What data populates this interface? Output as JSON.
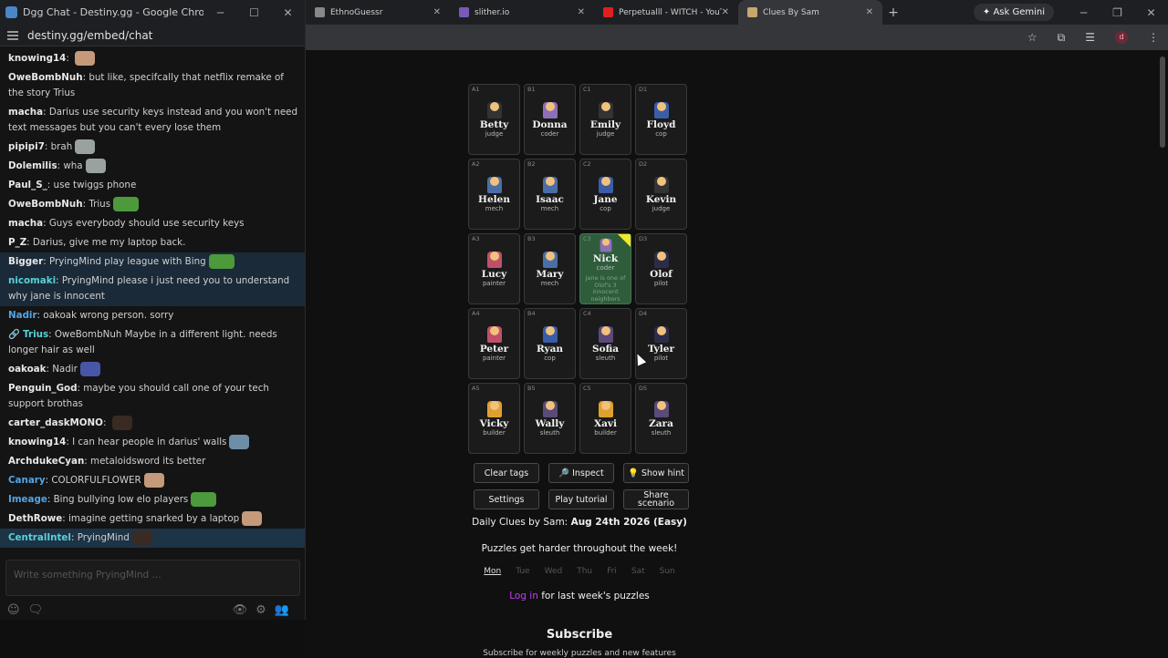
{
  "chat_window": {
    "title": "Dgg Chat - Destiny.gg - Google Chrome",
    "url": "destiny.gg/embed/chat",
    "input_placeholder": "Write something PryingMind ...",
    "messages": [
      {
        "user": "knowing14",
        "text": "",
        "emote": "face",
        "style": ""
      },
      {
        "user": "OweBombNuh",
        "text": "but like, specifcally that netflix remake of the story Trius",
        "emote": "",
        "style": ""
      },
      {
        "user": "macha",
        "text": "Darius use security keys instead and you won't need text messages but you can't every lose them",
        "emote": "",
        "style": ""
      },
      {
        "user": "pipipi7",
        "text": "brah",
        "emote": "grey",
        "style": ""
      },
      {
        "user": "Dolemilis",
        "text": "wha",
        "emote": "grey",
        "style": ""
      },
      {
        "user": "Paul_S_",
        "text": "use twiggs phone",
        "emote": "",
        "style": ""
      },
      {
        "user": "OweBombNuh",
        "text": "Trius",
        "emote": "pepe",
        "style": ""
      },
      {
        "user": "macha",
        "text": "Guys everybody should use security keys",
        "emote": "",
        "style": ""
      },
      {
        "user": "P_Z",
        "text": "Darius, give me my laptop back.",
        "emote": "",
        "style": ""
      },
      {
        "user": "Bigger",
        "text": "PryingMind play league with Bing",
        "emote": "pepe",
        "style": "hl"
      },
      {
        "user": "nicomaki",
        "text": "PryingMind please i just need you to understand why jane is innocent",
        "emote": "",
        "style": "hl-teal"
      },
      {
        "user": "Nadir",
        "text": "oakoak wrong person. sorry",
        "emote": "",
        "style": "blue"
      },
      {
        "user": "Trius",
        "text": "OweBombNuh Maybe in a different light. needs longer hair as well",
        "emote": "",
        "style": "teal-pre"
      },
      {
        "user": "oakoak",
        "text": "Nadir",
        "emote": "blueguy",
        "style": ""
      },
      {
        "user": "Penguin_God",
        "text": "maybe you should call one of your tech support brothas",
        "emote": "",
        "style": ""
      },
      {
        "user": "carter_daskMONO",
        "text": "",
        "emote": "dark",
        "style": ""
      },
      {
        "user": "knowing14",
        "text": "I can hear people in darius' walls",
        "emote": "photo",
        "style": ""
      },
      {
        "user": "ArchdukeCyan",
        "text": "metaloidsword its better",
        "emote": "",
        "style": ""
      },
      {
        "user": "Canary",
        "text": "COLORFULFLOWER",
        "emote": "face",
        "style": "blue"
      },
      {
        "user": "Imeage",
        "text": "Bing bullying low elo players",
        "emote": "pepe",
        "style": "blue"
      },
      {
        "user": "DethRowe",
        "text": "imagine getting snarked by a laptop",
        "emote": "face",
        "style": ""
      },
      {
        "user": "CentralIntel",
        "text": "PryingMind",
        "emote": "dark",
        "style": "own"
      }
    ]
  },
  "tabs": [
    {
      "label": "EthnoGuessr",
      "color": "#888888",
      "active": false
    },
    {
      "label": "slither.io",
      "color": "#7a5ab8",
      "active": false
    },
    {
      "label": "Perpetualll - WITCH - YouTube",
      "color": "#e02020",
      "active": false
    },
    {
      "label": "Clues By Sam",
      "color": "#c9a66b",
      "active": true
    }
  ],
  "gemini_label": "Ask Gemini",
  "profile_letter": "d",
  "grid": [
    {
      "coord": "A1",
      "name": "Betty",
      "role": "judge",
      "shirt": "#333333"
    },
    {
      "coord": "B1",
      "name": "Donna",
      "role": "coder",
      "shirt": "#8e6fb8"
    },
    {
      "coord": "C1",
      "name": "Emily",
      "role": "judge",
      "shirt": "#333333"
    },
    {
      "coord": "D1",
      "name": "Floyd",
      "role": "cop",
      "shirt": "#3a5da8"
    },
    {
      "coord": "A2",
      "name": "Helen",
      "role": "mech",
      "shirt": "#4a6fa8"
    },
    {
      "coord": "B2",
      "name": "Isaac",
      "role": "mech",
      "shirt": "#4a6fa8"
    },
    {
      "coord": "C2",
      "name": "Jane",
      "role": "cop",
      "shirt": "#3a5da8"
    },
    {
      "coord": "D2",
      "name": "Kevin",
      "role": "judge",
      "shirt": "#333333"
    },
    {
      "coord": "A3",
      "name": "Lucy",
      "role": "painter",
      "shirt": "#c0506a"
    },
    {
      "coord": "B3",
      "name": "Mary",
      "role": "mech",
      "shirt": "#4a6fa8"
    },
    {
      "coord": "C3",
      "name": "Nick",
      "role": "coder",
      "shirt": "#8e6fb8",
      "revealed": true,
      "hint": "Jane is one of Olof's 3 innocent neighbors"
    },
    {
      "coord": "D3",
      "name": "Olof",
      "role": "pilot",
      "shirt": "#2c2c4a"
    },
    {
      "coord": "A4",
      "name": "Peter",
      "role": "painter",
      "shirt": "#c0506a"
    },
    {
      "coord": "B4",
      "name": "Ryan",
      "role": "cop",
      "shirt": "#3a5da8"
    },
    {
      "coord": "C4",
      "name": "Sofia",
      "role": "sleuth",
      "shirt": "#5a4a7a"
    },
    {
      "coord": "D4",
      "name": "Tyler",
      "role": "pilot",
      "shirt": "#2c2c4a"
    },
    {
      "coord": "A5",
      "name": "Vicky",
      "role": "builder",
      "shirt": "#e0a030"
    },
    {
      "coord": "B5",
      "name": "Wally",
      "role": "sleuth",
      "shirt": "#5a4a7a"
    },
    {
      "coord": "C5",
      "name": "Xavi",
      "role": "builder",
      "shirt": "#e0a030"
    },
    {
      "coord": "D5",
      "name": "Zara",
      "role": "sleuth",
      "shirt": "#5a4a7a"
    }
  ],
  "buttons": {
    "clear_tags": "Clear tags",
    "inspect": "🔎 Inspect",
    "show_hint": "💡 Show hint",
    "settings": "Settings",
    "play_tutorial": "Play tutorial",
    "share_scenario": "Share scenario"
  },
  "daily": {
    "prefix": "Daily Clues by Sam: ",
    "date": "Aug 24th 2026 (Easy)"
  },
  "harder_text": "Puzzles get harder throughout the week!",
  "days": [
    "Mon",
    "Tue",
    "Wed",
    "Thu",
    "Fri",
    "Sat",
    "Sun"
  ],
  "current_day": "Mon",
  "login": {
    "link": "Log in",
    "rest": " for last week's puzzles"
  },
  "subscribe_title": "Subscribe",
  "subscribe_line": "Subscribe for weekly puzzles and new features"
}
